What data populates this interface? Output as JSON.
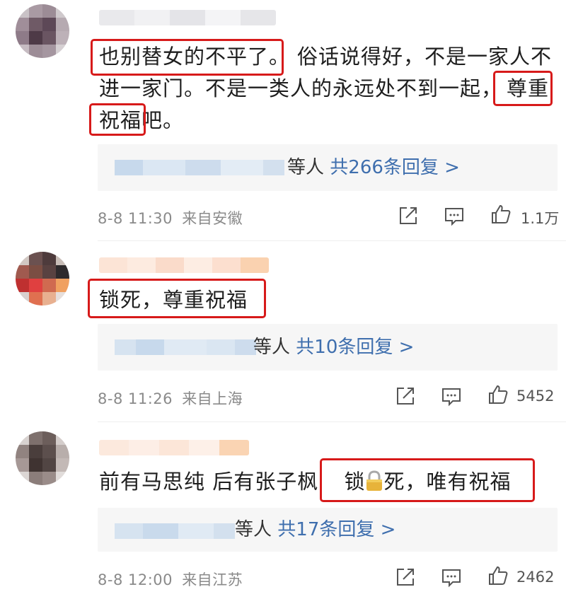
{
  "comments": [
    {
      "text_segments": [
        "也别替女的不平了。",
        "俗话说得好，不是一家人不",
        "进一家门。不是一类人的永远处不到一起，",
        "尊重",
        "祝福",
        "吧。"
      ],
      "replies_suffix": "等人",
      "replies_count": "共266条回复 >",
      "date": "8-8 11:30",
      "location": "来自安徽",
      "likes": "1.1万"
    },
    {
      "text": "锁死，尊重祝福",
      "replies_suffix": "等人",
      "replies_count": "共10条回复 >",
      "date": "8-8 11:26",
      "location": "来自上海",
      "likes": "5452"
    },
    {
      "text_prefix": "前有马思纯 后有张子枫",
      "text_hl_a": "锁",
      "text_hl_emoji": "lock-emoji",
      "text_hl_b": "死，唯有祝福",
      "replies_suffix": "等人",
      "replies_count": "共17条回复 >",
      "date": "8-8 12:00",
      "location": "来自江苏",
      "likes": "2462"
    }
  ],
  "icons": {
    "repost": "share-icon",
    "comment": "comment-icon",
    "like": "thumbs-up-icon"
  },
  "colors": {
    "highlight_border": "#d71a1a",
    "reply_link": "#3f6fae",
    "reply_bg": "#f6f6f6",
    "meta_text": "#8a8a8a"
  }
}
